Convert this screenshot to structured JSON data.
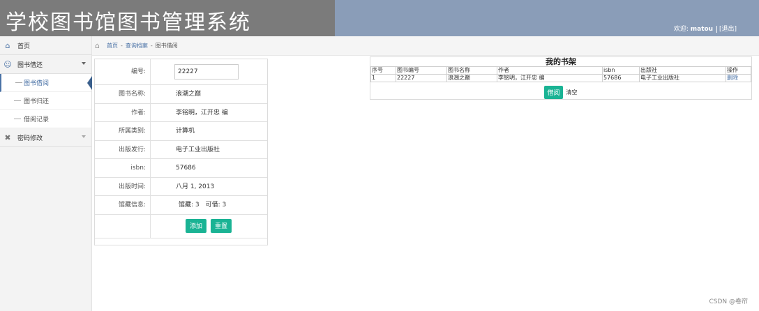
{
  "header": {
    "title": "学校图书馆图书管理系统",
    "welcome_label": "欢迎:",
    "username": "matou",
    "logout": "[退出]"
  },
  "sidebar": {
    "items": [
      {
        "label": "首页",
        "icon": "home-icon"
      },
      {
        "label": "图书借还",
        "icon": "user-icon",
        "expanded": true
      },
      {
        "label": "图书借阅"
      },
      {
        "label": "图书归还"
      },
      {
        "label": "借阅记录"
      },
      {
        "label": "密码修改",
        "icon": "tools-icon"
      }
    ]
  },
  "breadcrumb": {
    "home": "首页",
    "sep1": "-",
    "level2": "查询档案",
    "sep2": "-",
    "current": "图书借阅"
  },
  "form": {
    "id_label": "编号:",
    "id_value": "22227",
    "name_label": "图书名称:",
    "name_value": "浪潮之巅",
    "author_label": "作者:",
    "author_value": "李铭明，江开忠 编",
    "category_label": "所属类别:",
    "category_value": "计算机",
    "publisher_label": "出版发行:",
    "publisher_value": "电子工业出版社",
    "isbn_label": "isbn:",
    "isbn_value": "57686",
    "date_label": "出版时间:",
    "date_value": "八月 1, 2013",
    "stock_label": "馆藏信息:",
    "stock_value": "馆藏: 3　可借: 3",
    "add_button": "添加",
    "reset_button": "重置"
  },
  "shelf": {
    "title": "我的书架",
    "columns": [
      "序号",
      "图书编号",
      "图书名称",
      "作者",
      "isbn",
      "出版社",
      "操作"
    ],
    "rows": [
      [
        "1",
        "22227",
        "浪潮之巅",
        "李铭明，江开忠 编",
        "57686",
        "电子工业出版社",
        "删除"
      ]
    ],
    "borrow_button": "借阅",
    "clear_link": "清空"
  },
  "watermark": "CSDN @卷帘"
}
